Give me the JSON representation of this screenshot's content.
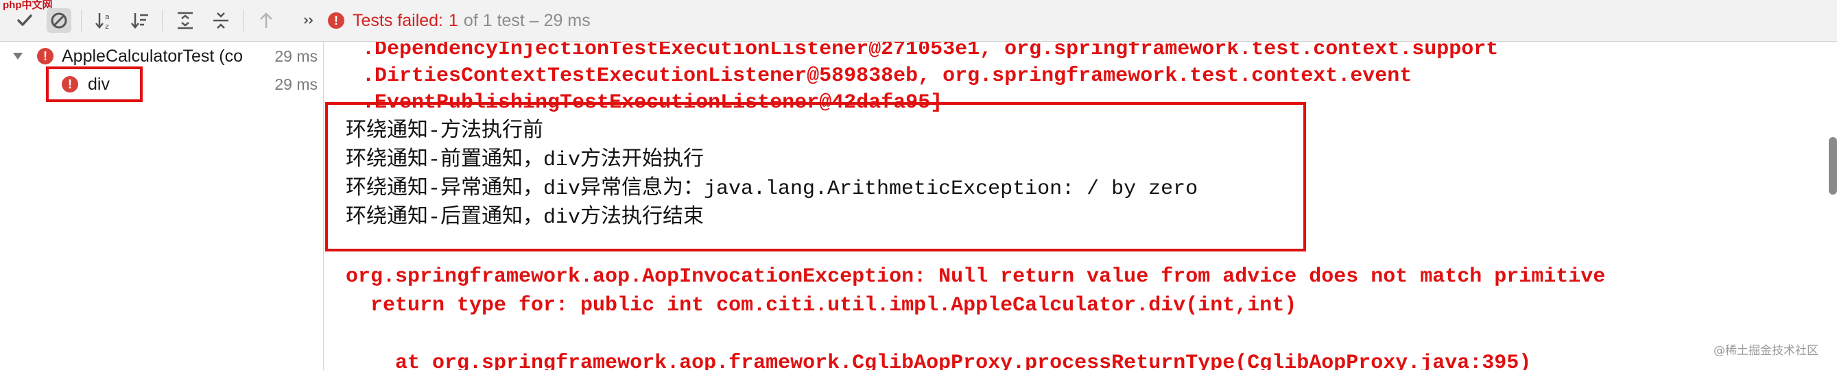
{
  "watermark_top": "php中文网",
  "toolbar": {
    "buttons": [
      {
        "icon": "checkmark-icon",
        "pressed": false
      },
      {
        "icon": "stop-icon",
        "pressed": true
      },
      {
        "icon": "sort-alpha-icon",
        "pressed": false
      },
      {
        "icon": "sort-duration-icon",
        "pressed": false
      },
      {
        "icon": "expand-all-icon",
        "pressed": false
      },
      {
        "icon": "collapse-all-icon",
        "pressed": false
      },
      {
        "icon": "arrow-up-icon",
        "pressed": false
      },
      {
        "icon": "more-chevrons-icon",
        "pressed": false
      }
    ]
  },
  "status": {
    "label": "Tests failed:",
    "count": "1",
    "rest": "of 1 test – 29 ms",
    "color": "#d41f1f"
  },
  "tree": {
    "root": {
      "name": "AppleCalculatorTest (co",
      "time": "29 ms",
      "expanded": true
    },
    "child": {
      "name": "div",
      "time": "29 ms"
    }
  },
  "console": {
    "lines": [
      {
        "text": "  .DependencyInjectionTestExecutionListener@271053e1, org.springframework.test.context.support",
        "style": "red"
      },
      {
        "text": "  .DirtiesContextTestExecutionListener@589838eb, org.springframework.test.context.event",
        "style": "red"
      },
      {
        "text": "  .EventPublishingTestExecutionListener@42dafa95]",
        "style": "red"
      },
      {
        "text": "环绕通知-方法执行前",
        "style": "black"
      },
      {
        "text": "环绕通知-前置通知，div方法开始执行",
        "style": "black"
      },
      {
        "text": "环绕通知-异常通知，div异常信息为：java.lang.ArithmeticException: / by zero",
        "style": "black"
      },
      {
        "text": "环绕通知-后置通知，div方法执行结束",
        "style": "black"
      },
      {
        "text": "org.springframework.aop.AopInvocationException: Null return value from advice does not match primitive",
        "style": "red"
      },
      {
        "text": "  return type for: public int com.citi.util.impl.AppleCalculator.div(int,int)",
        "style": "red"
      },
      {
        "text": "    at org.springframework.aop.framework.CglibAopProxy.processReturnType(CglibAopProxy.java:395)",
        "style": "red"
      }
    ]
  },
  "watermark": "@稀土掘金技术社区"
}
